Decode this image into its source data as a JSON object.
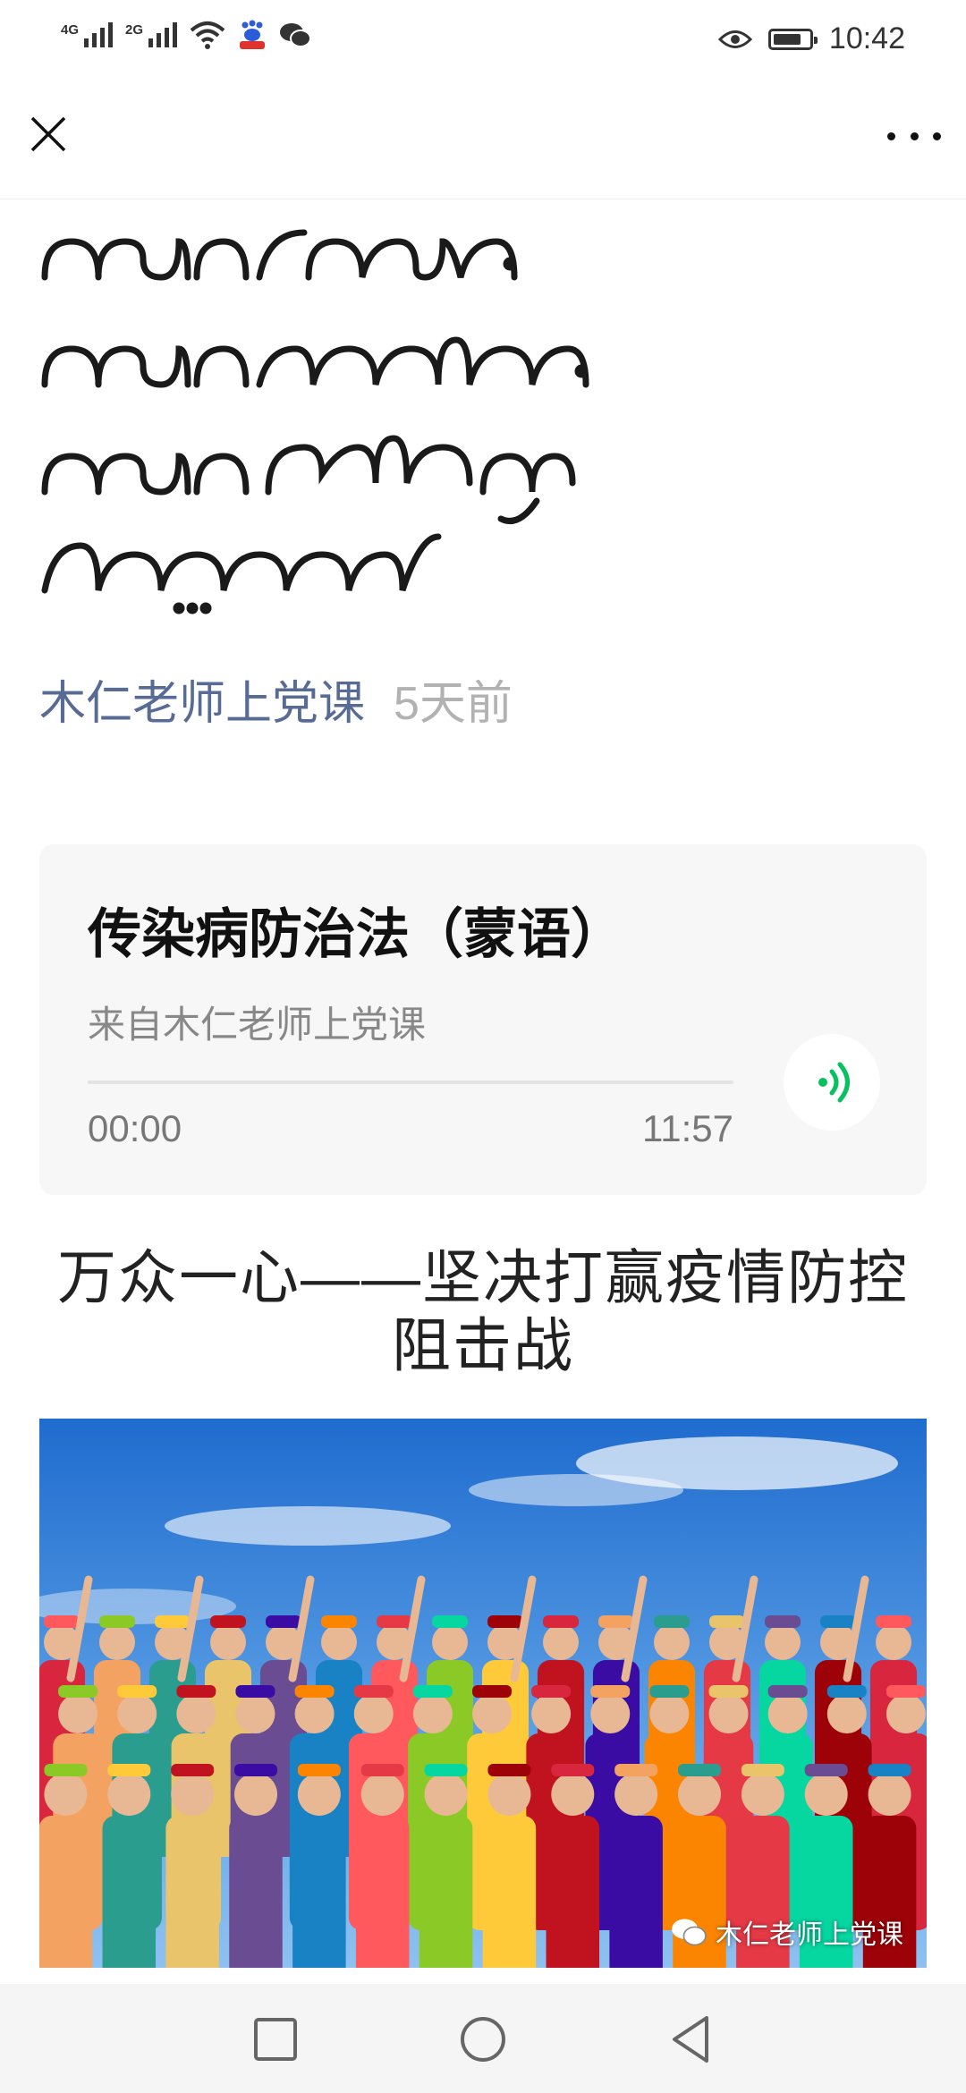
{
  "status_bar": {
    "signal_1_label": "4G",
    "signal_2_label": "2G",
    "time": "10:42",
    "battery_level": 0.7,
    "left_icons": [
      "signal-icon",
      "signal-icon",
      "wifi-icon",
      "baidu-icon",
      "wechat-icon"
    ],
    "right_icons": [
      "eye-icon",
      "battery-icon"
    ]
  },
  "top_nav": {
    "close_icon": "close-icon",
    "more_icon": "more-icon"
  },
  "article": {
    "title_lines": [
      "ᠬᠠᠯᠠᠳᠠᠪᠤᠷᠢ",
      "ᠭᠠᠭᠤᠷᠠᠯ",
      "ᠡᠮᠨᠡᠯᠭᠡ",
      "ᠬᠠᠮᠠᠭᠠᠯᠠᠯ"
    ],
    "author": "木仁老师上党课",
    "date": "5天前",
    "audio": {
      "title": "传染病防治法（蒙语）",
      "source": "来自木仁老师上党课",
      "current_time": "00:00",
      "duration": "11:57",
      "progress": 0,
      "accent_color": "#07c160"
    },
    "heading": "万众一心——坚决打赢疫情防控阻击战",
    "image_watermark": "木仁老师上党课"
  },
  "nav_bar": {
    "icons": [
      "recent-apps-icon",
      "home-icon",
      "back-icon"
    ]
  }
}
